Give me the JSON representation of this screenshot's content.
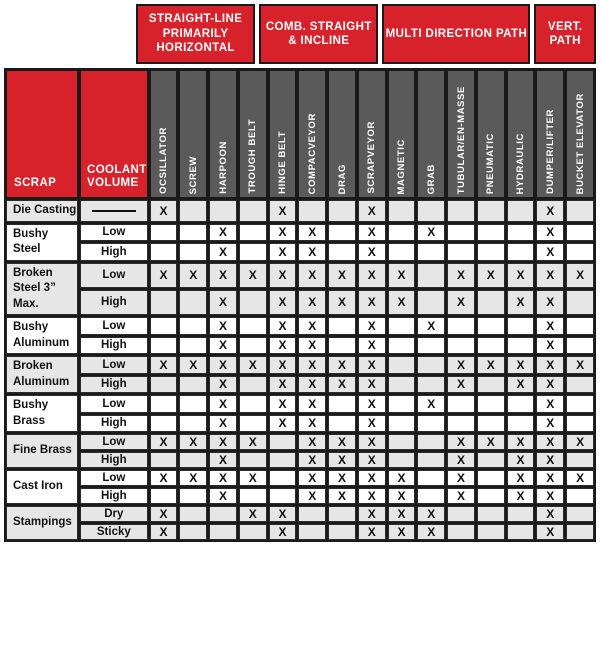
{
  "table": {
    "corner_headers": {
      "scrap": "SCRAP",
      "coolant_volume": "COOLANT VOLUME"
    },
    "colors": {
      "red": "#D8222B",
      "header_gray": "#5A5A5A",
      "row_shade": "#E6E6E6",
      "border": "#1a1a1a"
    },
    "groups": [
      {
        "label": "STRAIGHT-LINE PRIMARILY HORIZONTAL",
        "span": 4
      },
      {
        "label": "COMB. STRAIGHT & INCLINE",
        "span": 4
      },
      {
        "label": "MULTI DIRECTION PATH",
        "span": 5
      },
      {
        "label": "VERT. PATH",
        "span": 2
      }
    ],
    "columns": [
      "OCSILLATOR",
      "SCREW",
      "HARPOON",
      "TROUGH BELT",
      "HINGE BELT",
      "COMPACVEYOR",
      "DRAG",
      "SCRAPVEYOR",
      "MAGNETIC",
      "GRAB",
      "TUBULAR/EN-MASSE",
      "PNEUMATIC",
      "HYDRAULIC",
      "DUMPER/LIFTER",
      "BUCKET ELEVATOR"
    ],
    "mark": "X",
    "dash": "—",
    "rows": [
      {
        "scrap": "Die Casting",
        "coolant": "—",
        "coolant_is_dash": true,
        "shade": true,
        "marks": [
          1,
          0,
          0,
          0,
          1,
          0,
          0,
          1,
          0,
          0,
          0,
          0,
          0,
          1,
          0
        ]
      },
      {
        "scrap": "Bushy Steel",
        "coolant": "Low",
        "shade": false,
        "rowspan": 2,
        "marks": [
          0,
          0,
          1,
          0,
          1,
          1,
          0,
          1,
          0,
          1,
          0,
          0,
          0,
          1,
          0
        ]
      },
      {
        "scrap": "",
        "coolant": "High",
        "shade": false,
        "marks": [
          0,
          0,
          1,
          0,
          1,
          1,
          0,
          1,
          0,
          0,
          0,
          0,
          0,
          1,
          0
        ]
      },
      {
        "scrap": "Broken Steel 3” Max.",
        "coolant": "Low",
        "shade": true,
        "rowspan": 2,
        "marks": [
          1,
          1,
          1,
          1,
          1,
          1,
          1,
          1,
          1,
          0,
          1,
          1,
          1,
          1,
          1
        ]
      },
      {
        "scrap": "",
        "coolant": "High",
        "shade": true,
        "marks": [
          0,
          0,
          1,
          0,
          1,
          1,
          1,
          1,
          1,
          0,
          1,
          0,
          1,
          1,
          0
        ]
      },
      {
        "scrap": "Bushy Aluminum",
        "coolant": "Low",
        "shade": false,
        "rowspan": 2,
        "marks": [
          0,
          0,
          1,
          0,
          1,
          1,
          0,
          1,
          0,
          1,
          0,
          0,
          0,
          1,
          0
        ]
      },
      {
        "scrap": "",
        "coolant": "High",
        "shade": false,
        "marks": [
          0,
          0,
          1,
          0,
          1,
          1,
          0,
          1,
          0,
          0,
          0,
          0,
          0,
          1,
          0
        ]
      },
      {
        "scrap": "Broken Aluminum",
        "coolant": "Low",
        "shade": true,
        "rowspan": 2,
        "marks": [
          1,
          1,
          1,
          1,
          1,
          1,
          1,
          1,
          0,
          0,
          1,
          1,
          1,
          1,
          1
        ]
      },
      {
        "scrap": "",
        "coolant": "High",
        "shade": true,
        "marks": [
          0,
          0,
          1,
          0,
          1,
          1,
          1,
          1,
          0,
          0,
          1,
          0,
          1,
          1,
          0
        ]
      },
      {
        "scrap": "Bushy Brass",
        "coolant": "Low",
        "shade": false,
        "rowspan": 2,
        "marks": [
          0,
          0,
          1,
          0,
          1,
          1,
          0,
          1,
          0,
          1,
          0,
          0,
          0,
          1,
          0
        ]
      },
      {
        "scrap": "",
        "coolant": "High",
        "shade": false,
        "marks": [
          0,
          0,
          1,
          0,
          1,
          1,
          0,
          1,
          0,
          0,
          0,
          0,
          0,
          1,
          0
        ]
      },
      {
        "scrap": "Fine Brass",
        "coolant": "Low",
        "shade": true,
        "rowspan": 2,
        "marks": [
          1,
          1,
          1,
          1,
          0,
          1,
          1,
          1,
          0,
          0,
          1,
          1,
          1,
          1,
          1
        ]
      },
      {
        "scrap": "",
        "coolant": "High",
        "shade": true,
        "marks": [
          0,
          0,
          1,
          0,
          0,
          1,
          1,
          1,
          0,
          0,
          1,
          0,
          1,
          1,
          0
        ]
      },
      {
        "scrap": "Cast Iron",
        "coolant": "Low",
        "shade": false,
        "rowspan": 2,
        "marks": [
          1,
          1,
          1,
          1,
          0,
          1,
          1,
          1,
          1,
          0,
          1,
          0,
          1,
          1,
          1
        ]
      },
      {
        "scrap": "",
        "coolant": "High",
        "shade": false,
        "marks": [
          0,
          0,
          1,
          0,
          0,
          1,
          1,
          1,
          1,
          0,
          1,
          0,
          1,
          1,
          0
        ]
      },
      {
        "scrap": "Stampings",
        "coolant": "Dry",
        "shade": true,
        "rowspan": 2,
        "marks": [
          1,
          0,
          0,
          1,
          1,
          0,
          0,
          1,
          1,
          1,
          0,
          0,
          0,
          1,
          0
        ]
      },
      {
        "scrap": "",
        "coolant": "Sticky",
        "shade": true,
        "marks": [
          1,
          0,
          0,
          0,
          1,
          0,
          0,
          1,
          1,
          1,
          0,
          0,
          0,
          1,
          0
        ]
      }
    ]
  }
}
